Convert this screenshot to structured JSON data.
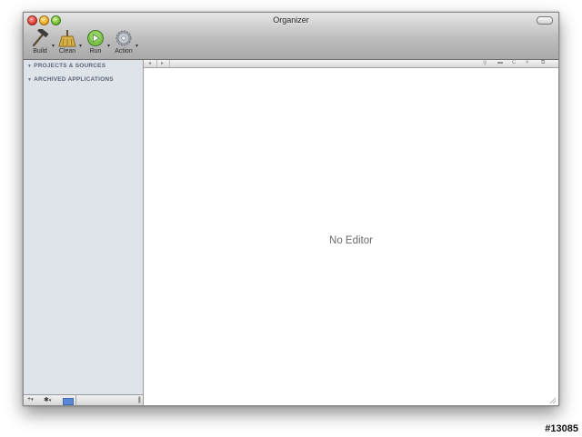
{
  "window": {
    "title": "Organizer"
  },
  "toolbar": {
    "items": [
      {
        "label": "Build",
        "icon": "hammer-icon"
      },
      {
        "label": "Clean",
        "icon": "broom-icon"
      },
      {
        "label": "Run",
        "icon": "play-icon"
      },
      {
        "label": "Action",
        "icon": "gear-icon"
      }
    ]
  },
  "sidebar": {
    "sections": [
      {
        "label": "PROJECTS & SOURCES",
        "expanded": true
      },
      {
        "label": "ARCHIVED APPLICATIONS",
        "expanded": true
      }
    ],
    "bottom_bar": {
      "add": "+",
      "action": "✱"
    }
  },
  "editor": {
    "placeholder_text": "No Editor"
  },
  "navbar": {
    "back": "◂",
    "forward": "▸",
    "right_controls": [
      "⚲",
      "▬",
      "C",
      "#",
      "⧉"
    ]
  },
  "watermark": "#13085",
  "colors": {
    "sidebar_bg": "#dfe3ea",
    "section_header": "#5b6576",
    "titlebar_top": "#e6e6e6",
    "titlebar_bottom": "#a9a9a9"
  }
}
